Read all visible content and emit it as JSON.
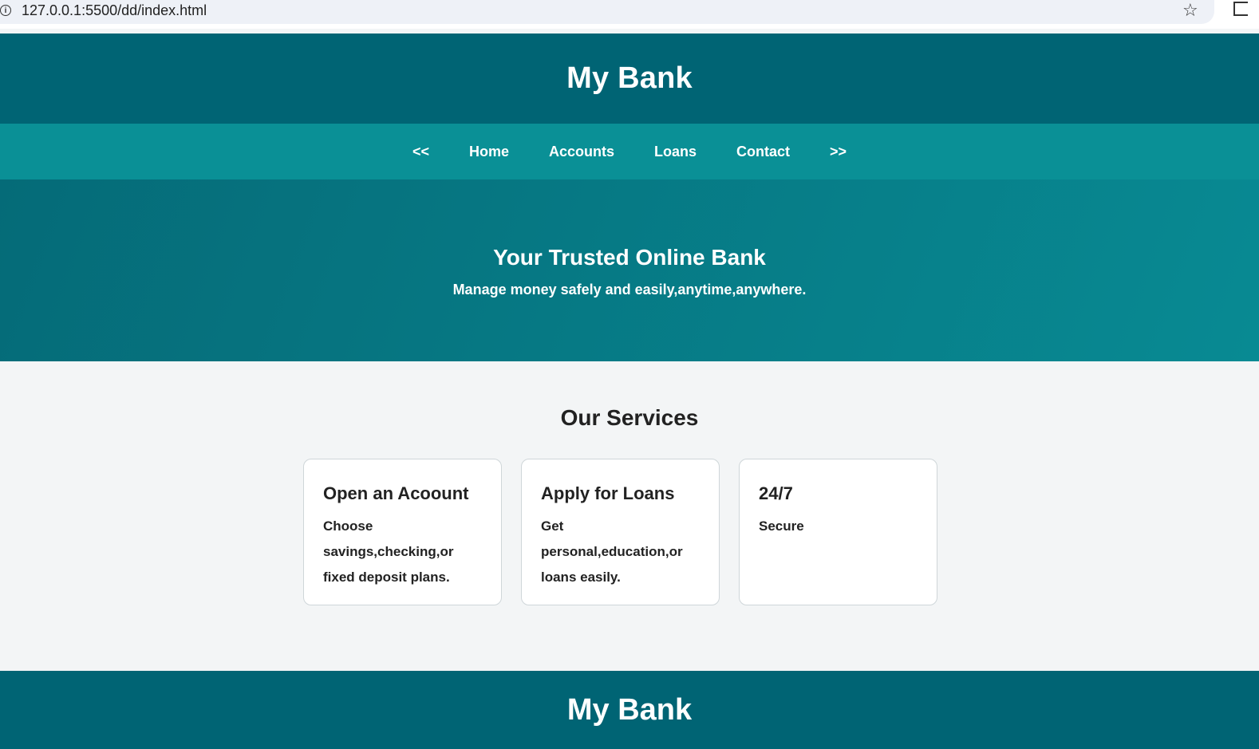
{
  "browser": {
    "url": "127.0.0.1:5500/dd/index.html",
    "info_icon": "info-icon",
    "star_icon": "star-icon",
    "extension_icon": "extension-icon"
  },
  "header": {
    "title": "My Bank"
  },
  "nav": {
    "items": [
      "<<",
      "Home",
      "Accounts",
      "Loans",
      "Contact",
      ">>"
    ]
  },
  "hero": {
    "title": "Your Trusted Online Bank",
    "subtitle": "Manage money safely and easily,anytime,anywhere."
  },
  "services": {
    "title": "Our Services",
    "cards": [
      {
        "title": "Open an Acoount",
        "text": "Choose savings,checking,or fixed deposit plans."
      },
      {
        "title": "Apply for Loans",
        "text": "Get personal,education,or loans easily."
      },
      {
        "title": "24/7",
        "text": "Secure"
      }
    ]
  },
  "footer": {
    "title": "My Bank"
  },
  "colors": {
    "header_bg": "#006474",
    "nav_bg": "#0a9096",
    "page_bg": "#f3f5f6"
  }
}
